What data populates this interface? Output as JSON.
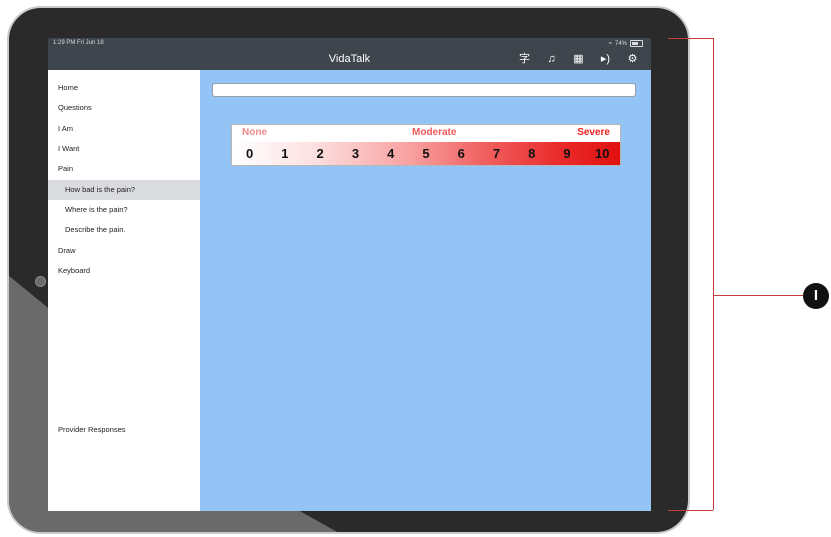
{
  "status": {
    "time": "1:29 PM  Fri Jun 18",
    "battery": "74%"
  },
  "app": {
    "title": "VidaTalk"
  },
  "nav_icons": [
    "language-icon",
    "music-icon",
    "calendar-icon",
    "speaker-icon",
    "gear-icon"
  ],
  "sidebar": {
    "items": [
      {
        "label": "Home"
      },
      {
        "label": "Questions"
      },
      {
        "label": "I Am"
      },
      {
        "label": "I Want"
      },
      {
        "label": "Pain"
      },
      {
        "label": "How bad is the pain?"
      },
      {
        "label": "Where is the pain?"
      },
      {
        "label": "Describe the pain."
      },
      {
        "label": "Draw"
      },
      {
        "label": "Keyboard"
      }
    ],
    "footer": {
      "label": "Provider Responses"
    }
  },
  "text_entry": {
    "value": ""
  },
  "pain_scale": {
    "low_label": "None",
    "mid_label": "Moderate",
    "high_label": "Severe",
    "numbers": [
      "0",
      "1",
      "2",
      "3",
      "4",
      "5",
      "6",
      "7",
      "8",
      "9",
      "10"
    ]
  },
  "callout": {
    "label": "I"
  },
  "colors": {
    "sidebar_bg": "#ffffff",
    "content_bg": "#93c4f5",
    "navbar_bg": "#3e454d",
    "selected_bg": "#d9dbdf",
    "callout_line": "#c43c3c"
  }
}
